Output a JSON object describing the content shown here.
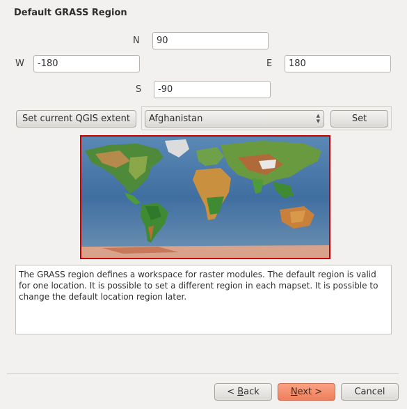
{
  "page": {
    "title": "Default GRASS Region"
  },
  "extent": {
    "n_label": "N",
    "n_value": "90",
    "w_label": "W",
    "w_value": "-180",
    "e_label": "E",
    "e_value": "180",
    "s_label": "S",
    "s_value": "-90"
  },
  "controls": {
    "set_current_extent_label": "Set current QGIS extent",
    "region_selected": "Afghanistan",
    "set_label": "Set"
  },
  "description": "The GRASS region defines a workspace for raster modules. The default region is valid for one location. It is possible to set a different region in each mapset. It is possible to change the default location region later.",
  "footer": {
    "back_prefix": "< ",
    "back_mnemonic": "B",
    "back_rest": "ack",
    "next_mnemonic": "N",
    "next_rest": "ext >",
    "cancel_label": "Cancel"
  },
  "colors": {
    "accent": "#ee7f5c",
    "map_border": "#c40000",
    "background": "#f2f1f0"
  },
  "icons": {
    "combo": "up-down-arrows-icon"
  }
}
